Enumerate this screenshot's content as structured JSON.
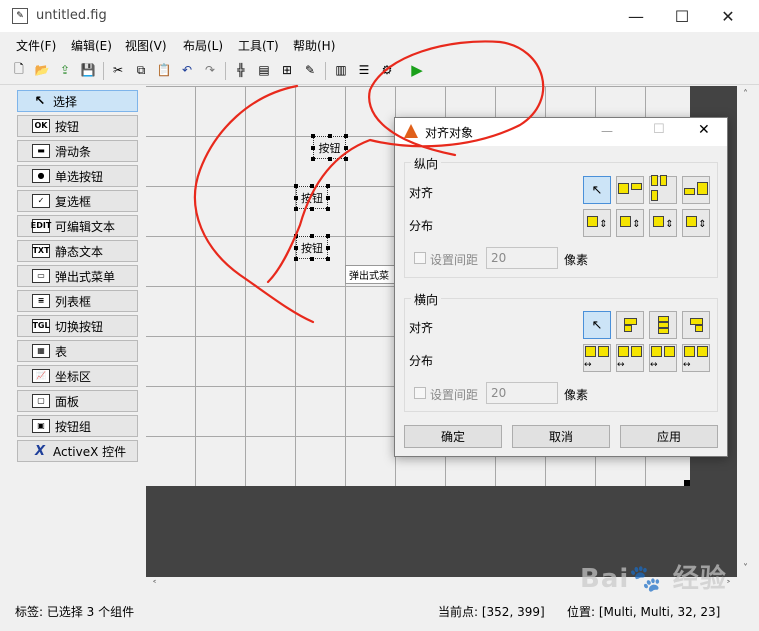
{
  "window": {
    "title": "untitled.fig"
  },
  "menu": [
    "文件(F)",
    "编辑(E)",
    "视图(V)",
    "布局(L)",
    "工具(T)",
    "帮助(H)"
  ],
  "palette": [
    {
      "label": "选择",
      "icon": "cursor-icon",
      "glyph": "↖",
      "selected": true
    },
    {
      "label": "按钮",
      "icon": "push-button-icon",
      "glyph": "OK"
    },
    {
      "label": "滑动条",
      "icon": "slider-icon",
      "glyph": "▬"
    },
    {
      "label": "单选按钮",
      "icon": "radio-button-icon",
      "glyph": "●"
    },
    {
      "label": "复选框",
      "icon": "checkbox-icon",
      "glyph": "✓"
    },
    {
      "label": "可编辑文本",
      "icon": "edit-text-icon",
      "glyph": "EDIT"
    },
    {
      "label": "静态文本",
      "icon": "static-text-icon",
      "glyph": "TXT"
    },
    {
      "label": "弹出式菜单",
      "icon": "popup-menu-icon",
      "glyph": "▭"
    },
    {
      "label": "列表框",
      "icon": "listbox-icon",
      "glyph": "≡"
    },
    {
      "label": "切换按钮",
      "icon": "toggle-button-icon",
      "glyph": "TGL"
    },
    {
      "label": "表",
      "icon": "table-icon",
      "glyph": "▦"
    },
    {
      "label": "坐标区",
      "icon": "axes-icon",
      "glyph": "📈"
    },
    {
      "label": "面板",
      "icon": "panel-icon",
      "glyph": "▢"
    },
    {
      "label": "按钮组",
      "icon": "button-group-icon",
      "glyph": "▣"
    },
    {
      "label": "ActiveX 控件",
      "icon": "activex-icon",
      "glyph": "X"
    }
  ],
  "canvas": {
    "buttons": [
      "按钮",
      "按钮",
      "按钮"
    ],
    "popup_label": "弹出式菜"
  },
  "dialog": {
    "title": "对齐对象",
    "vertical": {
      "group_label": "纵向",
      "align_label": "对齐",
      "distribute_label": "分布",
      "spacing_label": "设置间距",
      "spacing_value": "20",
      "unit": "像素"
    },
    "horizontal": {
      "group_label": "横向",
      "align_label": "对齐",
      "distribute_label": "分布",
      "spacing_label": "设置间距",
      "spacing_value": "20",
      "unit": "像素"
    },
    "ok": "确定",
    "cancel": "取消",
    "apply": "应用"
  },
  "status": {
    "tag": "标签: 已选择 3 个组件",
    "current_point": "当前点:  [352, 399]",
    "position": "位置: [Multi, Multi, 32, 23]"
  },
  "colors": {
    "annotation": "#e8291c",
    "selected_bg": "#cce4f7",
    "dark_area": "#434343"
  }
}
